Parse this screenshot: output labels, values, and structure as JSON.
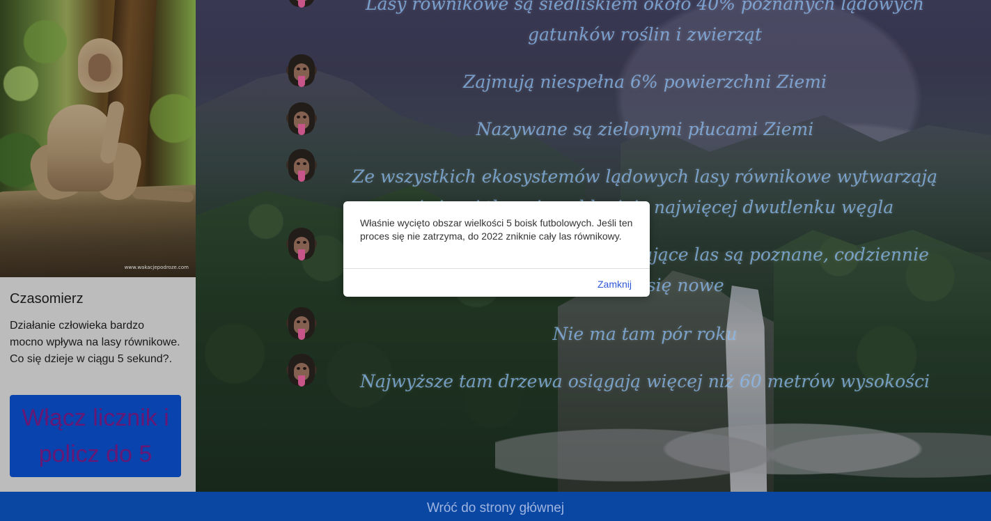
{
  "sidebar": {
    "photo_watermark": "www.wakacjepodroze.com",
    "timer": {
      "title": "Czasomierz",
      "description": "Działanie człowieka bardzo mocno wpływa na lasy równikowe. Co się dzieje w ciągu 5 sekund?.",
      "button_label": "Włącz licznik i policz do 5"
    }
  },
  "main": {
    "facts": [
      "Lasy równikowe są siedliskiem około 40% poznanych lądowych gatunków roślin i zwierząt",
      "Zajmują niespełna 6% powierzchni Ziemi",
      "Nazywane są zielonymi płucami Ziemi",
      "Ze wszystkich ekosystemów lądowych lasy równikowe wytwarzają najwięcej tlenu i pochłaniają najwięcej dwutlenku węgla",
      "Nie wszystkie gatunki zamieszkujące las są poznane, codziennie odkrywa się nowe",
      "Nie ma tam pór roku",
      "Najwyższe tam drzewa osiągają więcej niż 60 metrów wysokości"
    ]
  },
  "modal": {
    "message": "Właśnie wycięto obszar wielkości 5 boisk futbolowych. Jeśli ten proces się nie zatrzyma, do 2022 zniknie cały las równikowy.",
    "close_label": "Zamknij"
  },
  "footer": {
    "link_label": "Wróć do strony głównej"
  },
  "icons": {
    "fact_marker": "chimpanzee-face-icon"
  },
  "colors": {
    "fact_text": "#95c8ff",
    "timer_button_bg": "#0a48b8",
    "timer_button_text": "#6d1a7c",
    "footer_bg": "#0a47a3",
    "modal_link": "#2f57d8"
  }
}
